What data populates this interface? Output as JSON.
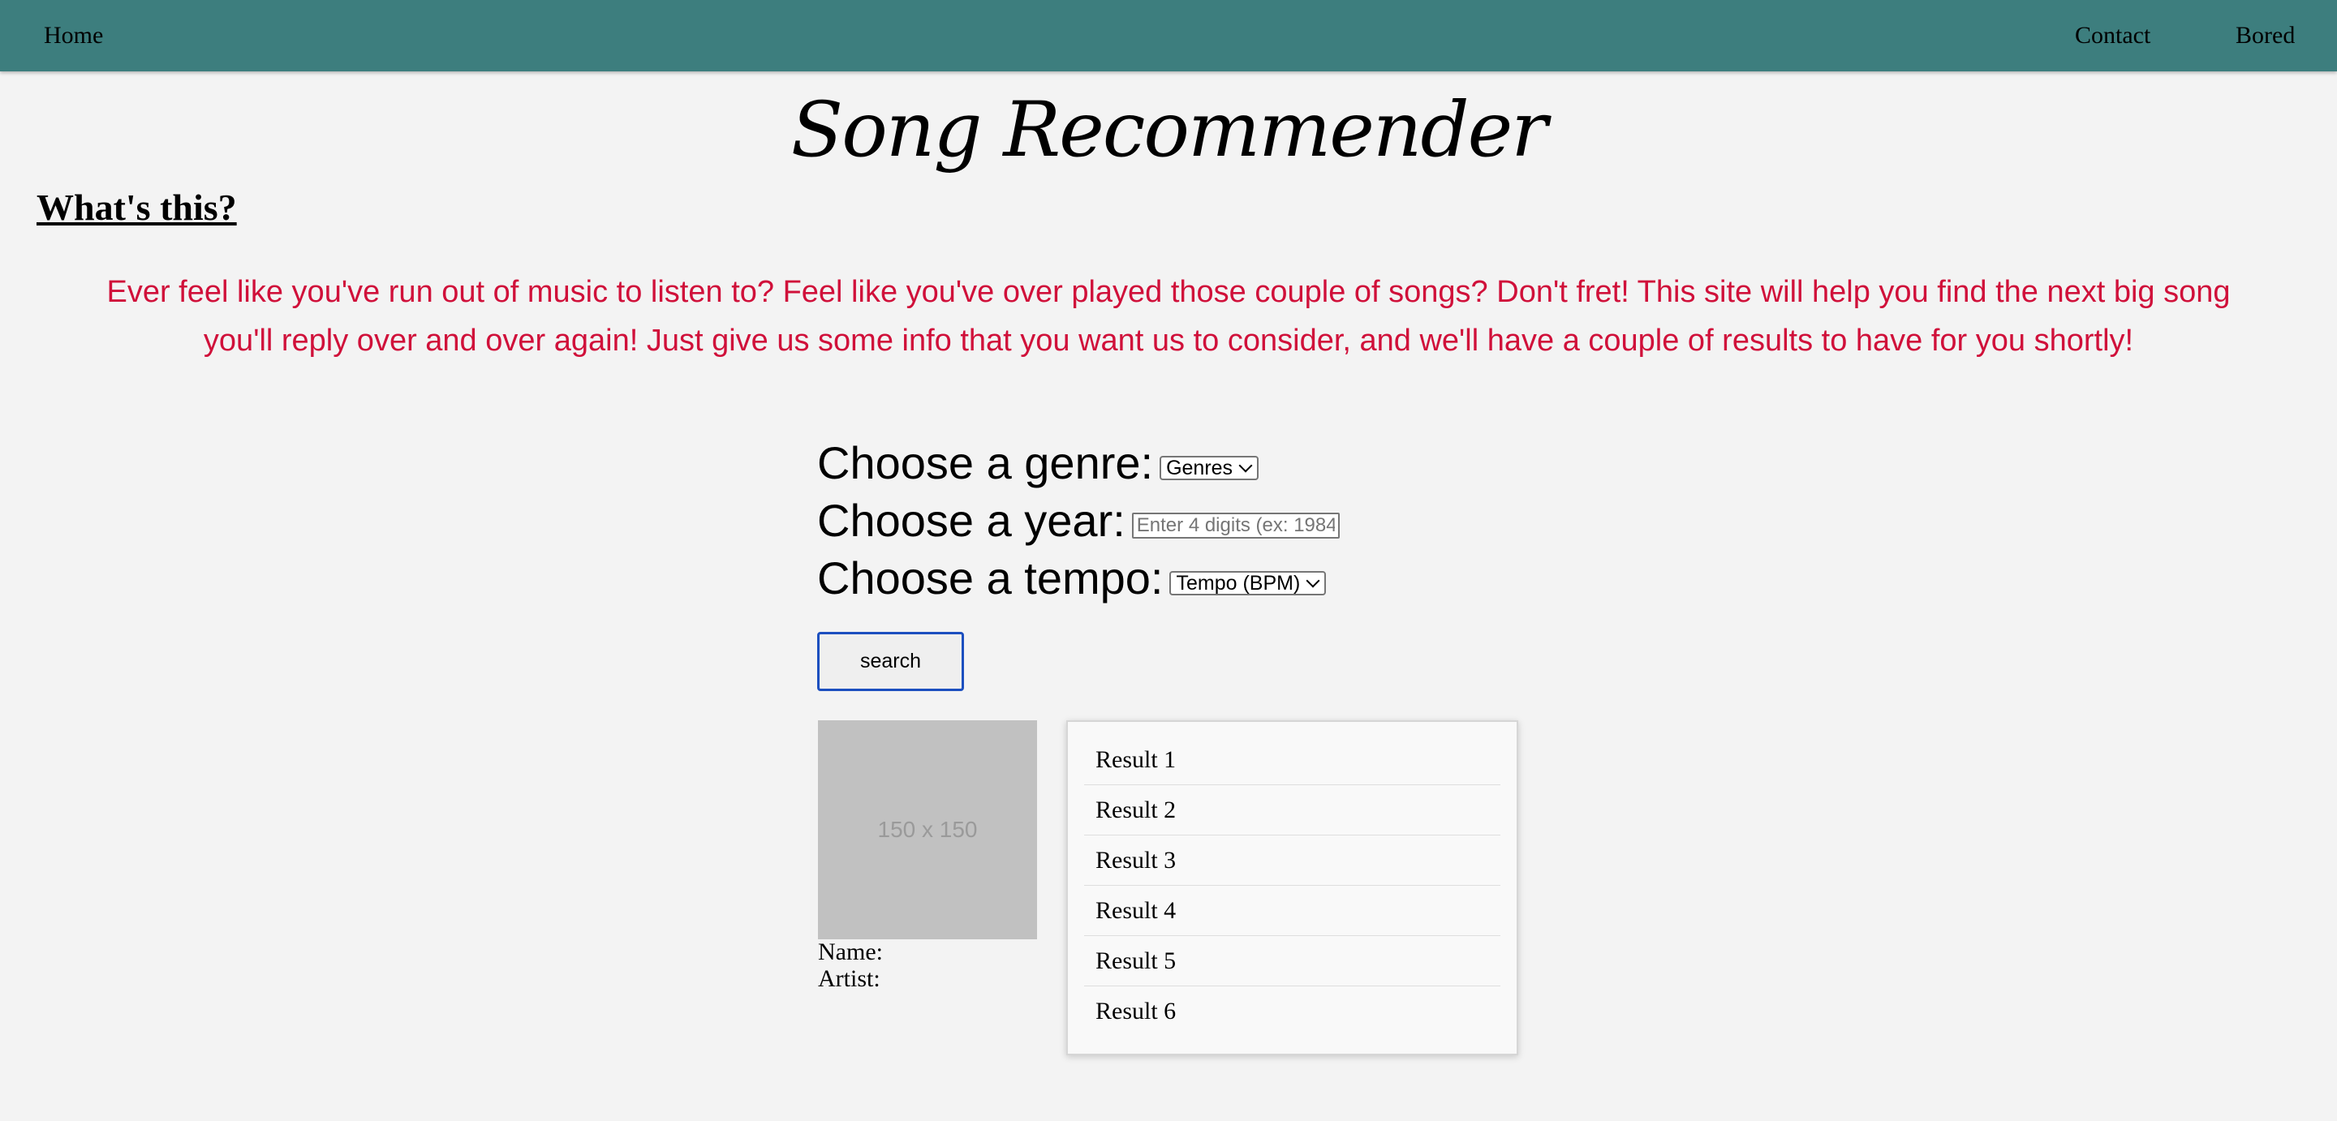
{
  "nav": {
    "home": "Home",
    "contact": "Contact",
    "bored": "Bored"
  },
  "page": {
    "title": "Song Recommender",
    "whats_this": "What's this?",
    "intro": "Ever feel like you've run out of music to listen to? Feel like you've over played those couple of songs? Don't fret! This site will help you find the next big song you'll reply over and over again! Just give us some info that you want us to consider, and we'll have a couple of results to have for you shortly!"
  },
  "form": {
    "genre_label": "Choose a genre:",
    "genre_selected": "Genres",
    "year_label": "Choose a year:",
    "year_placeholder": "Enter 4 digits (ex: 1984)",
    "year_value": "",
    "tempo_label": "Choose a tempo:",
    "tempo_selected": "Tempo (BPM)",
    "search_label": "search"
  },
  "song": {
    "image_placeholder": "150 x 150",
    "name_label": "Name:",
    "artist_label": "Artist:"
  },
  "results": [
    "Result 1",
    "Result 2",
    "Result 3",
    "Result 4",
    "Result 5",
    "Result 6"
  ],
  "colors": {
    "navbar": "#3d7e7e",
    "background": "#f3f3f3",
    "intro_text": "#d0103a",
    "button_focus": "#1c4fbf"
  }
}
